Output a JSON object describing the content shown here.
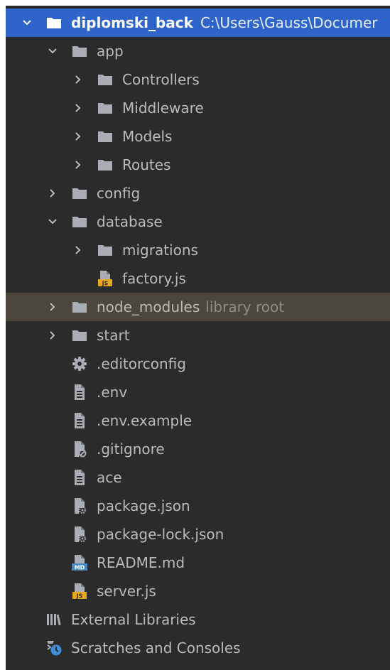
{
  "tree": {
    "root": {
      "name": "diplomski_back",
      "path": "C:\\Users\\Gauss\\Documer"
    },
    "items": [
      {
        "label": "app"
      },
      {
        "label": "Controllers"
      },
      {
        "label": "Middleware"
      },
      {
        "label": "Models"
      },
      {
        "label": "Routes"
      },
      {
        "label": "config"
      },
      {
        "label": "database"
      },
      {
        "label": "migrations"
      },
      {
        "label": "factory.js"
      },
      {
        "label": "node_modules",
        "suffix": "library root"
      },
      {
        "label": "start"
      },
      {
        "label": ".editorconfig"
      },
      {
        "label": ".env"
      },
      {
        "label": ".env.example"
      },
      {
        "label": ".gitignore"
      },
      {
        "label": "ace"
      },
      {
        "label": "package.json"
      },
      {
        "label": "package-lock.json"
      },
      {
        "label": "README.md"
      },
      {
        "label": "server.js"
      },
      {
        "label": "External Libraries"
      },
      {
        "label": "Scratches and Consoles"
      }
    ]
  },
  "icons": {
    "js_badge": "JS",
    "md_badge": "MD"
  },
  "colors": {
    "background": "#2b2b2b",
    "selection": "#2f65ca",
    "highlight_row": "#4c473c",
    "text": "#bbbbbb",
    "muted": "#8c8c8c",
    "folder": "#a9aeb5",
    "js_yellow": "#e7a81b",
    "md_blue": "#4a89c8",
    "scratch_blue": "#3f8fd9"
  }
}
